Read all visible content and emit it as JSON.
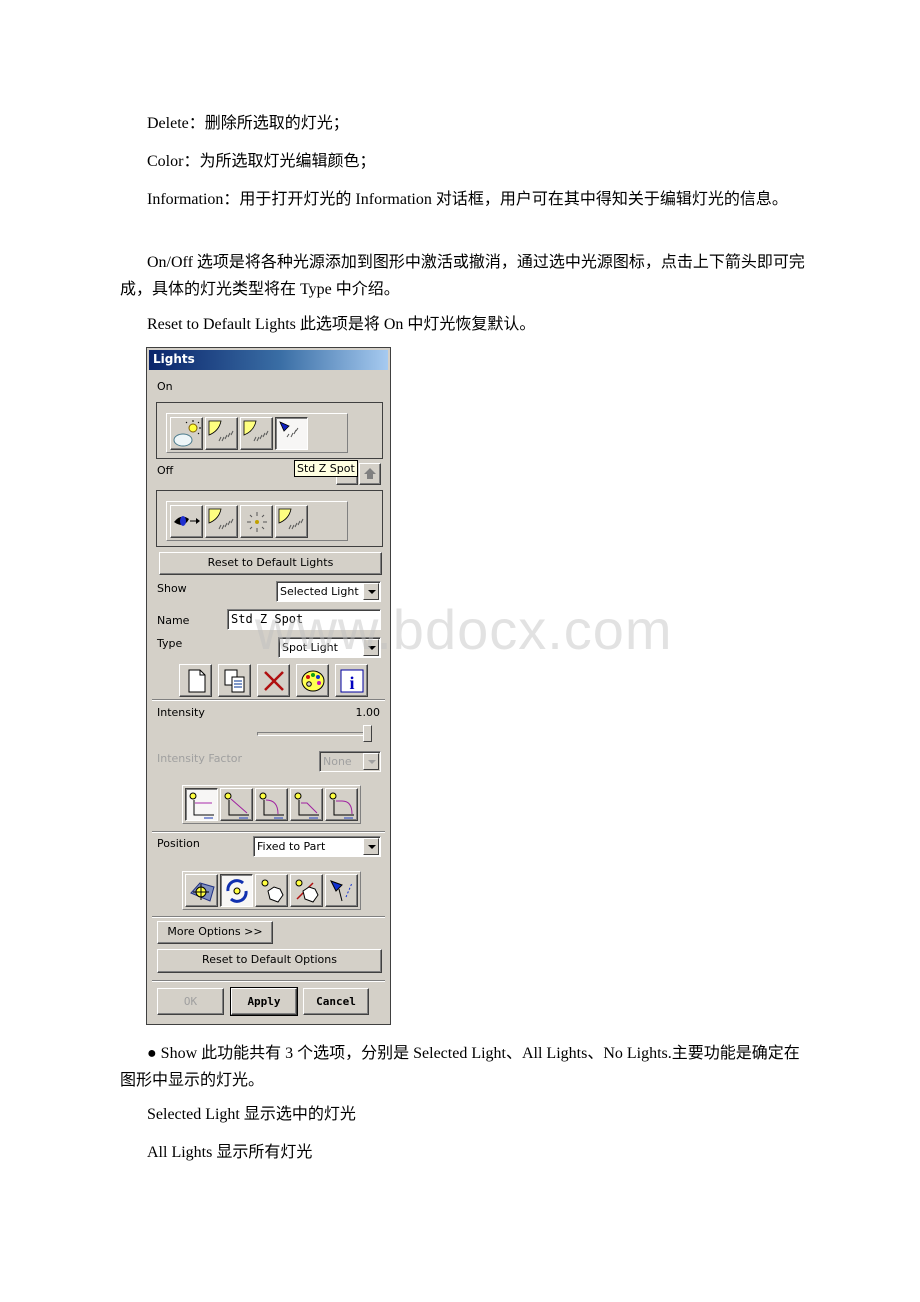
{
  "document": {
    "paragraphs": [
      "Delete：删除所选取的灯光；",
      "Color：为所选取灯光编辑颜色；",
      "Information：用于打开灯光的 Information 对话框，用户可在其中得知关于编辑灯光的信息。",
      "On/Off 选项是将各种光源添加到图形中激活或撤消，通过选中光源图标，点击上下箭头即可完成，具体的灯光类型将在 Type 中介绍。",
      "Reset to Default Lights 此选项是将 On 中灯光恢复默认。"
    ],
    "after_paragraphs": [
      "● Show 此功能共有 3 个选项，分别是 Selected Light、All Lights、No Lights.主要功能是确定在图形中显示的灯光。",
      "Selected Light 显示选中的灯光",
      "All Lights 显示所有灯光"
    ],
    "watermark": "www.bdocx.com"
  },
  "dialog": {
    "title": "Lights",
    "on_label": "On",
    "off_label": "Off",
    "on_lights": [
      {
        "icon": "ambient-light-icon",
        "pressed": false
      },
      {
        "icon": "distant-light-icon",
        "pressed": false
      },
      {
        "icon": "distant-light-icon",
        "pressed": false
      },
      {
        "icon": "spot-light-icon",
        "pressed": true
      }
    ],
    "off_lights": [
      {
        "icon": "eye-light-icon"
      },
      {
        "icon": "distant-light-icon"
      },
      {
        "icon": "point-light-icon"
      },
      {
        "icon": "distant-light-icon"
      }
    ],
    "tooltip": "Std Z Spot",
    "reset_lights_label": "Reset to Default Lights",
    "show_label": "Show",
    "show_value": "Selected Light",
    "name_label": "Name",
    "name_value": "Std Z Spot",
    "type_label": "Type",
    "type_value": "Spot Light",
    "intensity_label": "Intensity",
    "intensity_value": "1.00",
    "intensity_fraction": 1.0,
    "intensity_factor_label": "Intensity Factor",
    "intensity_factor_value": "None",
    "position_label": "Position",
    "position_value": "Fixed to Part",
    "more_options_label": "More Options >>",
    "reset_options_label": "Reset to Default Options",
    "ok_label": "OK",
    "apply_label": "Apply",
    "cancel_label": "Cancel"
  }
}
